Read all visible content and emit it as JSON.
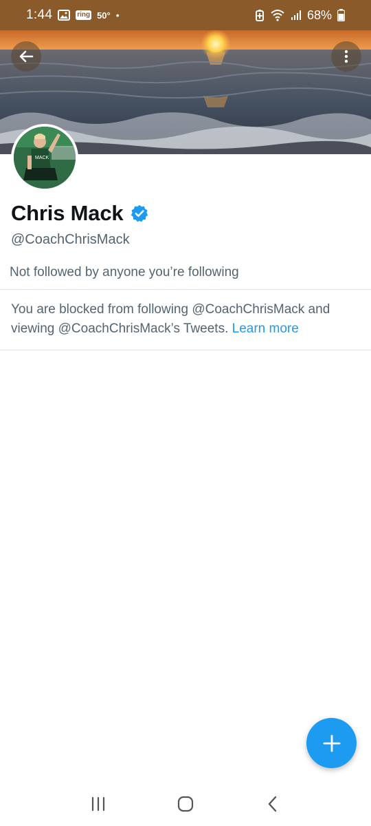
{
  "status_bar": {
    "time": "1:44",
    "ring_label": "ring",
    "temperature": "50°",
    "dot": "•",
    "battery_percent": "68%",
    "icons": [
      "image-icon",
      "ring-icon",
      "battery-saver-icon",
      "wifi-icon",
      "signal-icon",
      "battery-icon"
    ],
    "background_color": "#8a5a2b"
  },
  "header": {
    "back_icon": "arrow-left-icon",
    "more_icon": "more-vertical-icon"
  },
  "profile": {
    "display_name": "Chris Mack",
    "verified_icon": "verified-badge-icon",
    "handle": "@CoachChrisMack",
    "followed_by": "Not followed by anyone you’re following"
  },
  "blocked_notice": {
    "text": "You are blocked from following @CoachChrisMack and viewing @CoachChrisMack’s Tweets.",
    "link_label": "Learn more"
  },
  "fab": {
    "icon": "plus-icon",
    "color": "#1d9bf0"
  },
  "nav_bar": {
    "recent_icon": "recent-apps-icon",
    "home_icon": "home-icon",
    "back_icon": "back-chevron-icon"
  },
  "colors": {
    "accent": "#1d9bf0",
    "secondary_text": "#536471",
    "primary_text": "#0f1419"
  }
}
